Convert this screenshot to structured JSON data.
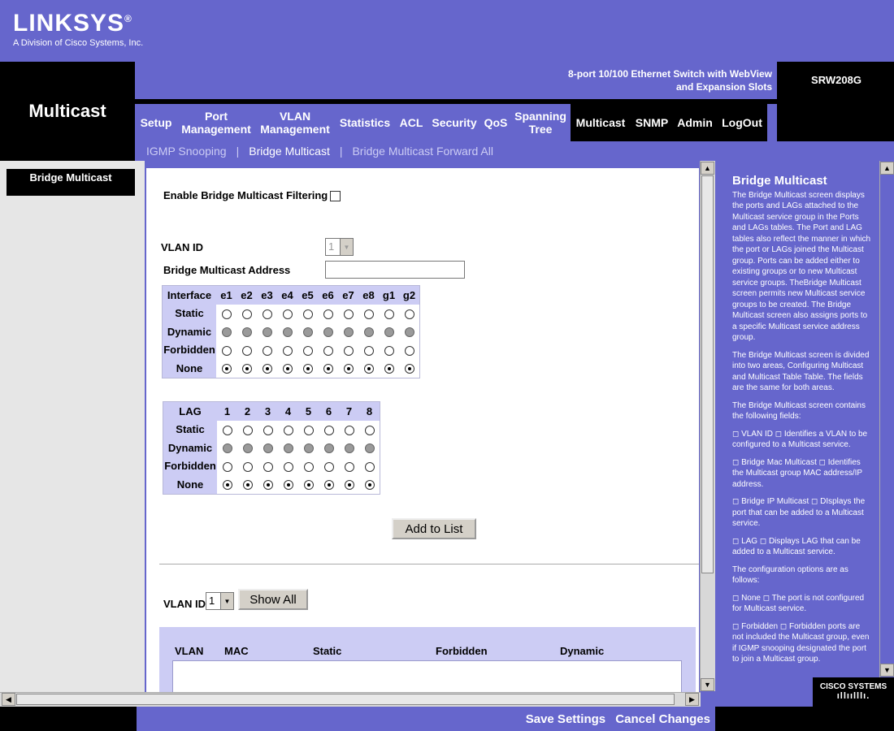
{
  "brand": {
    "logo": "LINKSYS",
    "registered": "®",
    "tagline": "A Division of Cisco Systems, Inc."
  },
  "section_title": "Multicast",
  "product": {
    "name_line1": "8-port 10/100 Ethernet Switch with WebView",
    "name_line2": "and Expansion Slots",
    "model": "SRW208G"
  },
  "tabs": [
    {
      "label": "Setup"
    },
    {
      "label": "Port\nManagement"
    },
    {
      "label": "VLAN\nManagement"
    },
    {
      "label": "Statistics"
    },
    {
      "label": "ACL"
    },
    {
      "label": "Security"
    },
    {
      "label": "QoS"
    },
    {
      "label": "Spanning\nTree"
    },
    {
      "label": "Multicast"
    },
    {
      "label": "SNMP"
    },
    {
      "label": "Admin"
    },
    {
      "label": "LogOut"
    }
  ],
  "subnav": {
    "item1": "IGMP Snooping",
    "sep": "|",
    "item2": "Bridge Multicast",
    "item3": "Bridge Multicast Forward All"
  },
  "leftnav": {
    "item": "Bridge Multicast"
  },
  "form": {
    "enable_label": "Enable Bridge Multicast Filtering",
    "vlan_label": "VLAN ID",
    "vlan_value": "1",
    "address_label": "Bridge Multicast Address",
    "address_value": "",
    "interface_header": "Interface",
    "interfaces": [
      "e1",
      "e2",
      "e3",
      "e4",
      "e5",
      "e6",
      "e7",
      "e8",
      "g1",
      "g2"
    ],
    "lag_header": "LAG",
    "lags": [
      "1",
      "2",
      "3",
      "4",
      "5",
      "6",
      "7",
      "8"
    ],
    "row_labels": [
      "Static",
      "Dynamic",
      "Forbidden",
      "None"
    ],
    "add_button": "Add to List",
    "vlan2_label": "VLAN ID",
    "vlan2_value": "1",
    "show_all": "Show All"
  },
  "mcast_table": {
    "col_vlan": "VLAN",
    "col_mac": "MAC",
    "col_static": "Static",
    "col_forbidden": "Forbidden",
    "col_dynamic": "Dynamic"
  },
  "help": {
    "title": "Bridge Multicast",
    "p1": "The Bridge Multicast screen displays the ports and LAGs attached to the Multicast service group in the Ports and LAGs tables. The Port and LAG tables also reflect the manner in which the port or LAGs joined the Multicast group. Ports can be added either to existing groups or to new Multicast service groups. TheBridge Multicast screen permits new Multicast service groups to be created. The Bridge Multicast screen also assigns ports to a specific Multicast service address group.",
    "p2": "The Bridge Multicast screen is divided into two areas, Configuring Multicast and Multicast Table Table. The fields are the same for both areas.",
    "p3": "The Bridge Multicast screen contains the following fields:",
    "p4": "◻ VLAN ID ◻ Identifies a VLAN to be configured to a Multicast service.",
    "p5": "◻ Bridge Mac Multicast ◻ Identifies the Multicast group MAC address/IP address.",
    "p6": "◻ Bridge IP Multicast ◻ DIsplays the port that can be added to a Multicast service.",
    "p7": "◻ LAG ◻ Displays LAG that can be added to a Multicast service.",
    "p8": "The configuration options are as follows:",
    "p9": "◻ None ◻ The port is not configured for Multicast service.",
    "p10": "◻ Forbidden ◻ Forbidden ports are not included the Multicast group, even if IGMP snooping designated the port to join a Multicast group."
  },
  "cisco_logo": "CISCO SYSTEMS",
  "footer": {
    "save": "Save Settings",
    "cancel": "Cancel Changes"
  },
  "colors": {
    "brand_purple": "#6666cc",
    "table_header": "#ccccf4",
    "black": "#000000"
  }
}
